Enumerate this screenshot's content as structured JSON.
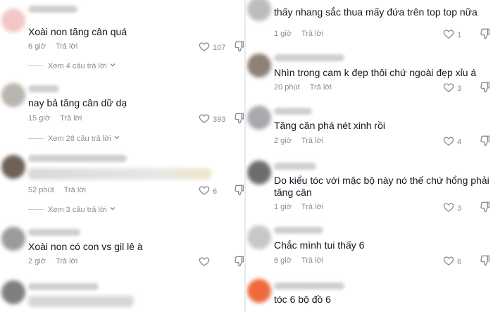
{
  "left": {
    "comments": [
      {
        "text": "Xoài non tăng cân quá",
        "time": "6 giờ",
        "reply": "Trả lời",
        "likes": "107",
        "view_replies": "Xem 4 câu trả lời",
        "avatar_color": "#f2c7c7"
      },
      {
        "text": "nay bả tăng cân dữ dạ",
        "time": "15 giờ",
        "reply": "Trả lời",
        "likes": "393",
        "view_replies": "Xem 28 câu trả lời",
        "avatar_color": "#b8b4ae"
      },
      {
        "text": "",
        "time": "52 phút",
        "reply": "Trả lời",
        "likes": "6",
        "view_replies": "Xem 3 câu trả lời",
        "avatar_color": "#6e6257"
      },
      {
        "text": "Xoài non có con vs gil lê à",
        "time": "2 giờ",
        "reply": "Trả lời",
        "likes": "",
        "avatar_color": "#9c9a9a"
      },
      {
        "text": "",
        "time": "",
        "reply": "",
        "likes": "",
        "avatar_color": "#7f7f7f"
      }
    ]
  },
  "right": {
    "comments": [
      {
        "text": "thấy nhang sắc thua mấy đứa trên top top nữa",
        "time": "1 giờ",
        "reply": "Trả lời",
        "likes": "1",
        "avatar_color": "#bcbcbc"
      },
      {
        "text": "Nhìn trong cam k đẹp thôi chứ ngoài đẹp xỉu á",
        "time": "20 phút",
        "reply": "Trả lời",
        "likes": "3",
        "avatar_color": "#8d8176"
      },
      {
        "text": "Tăng cân phá nét xinh rồi",
        "time": "2 giờ",
        "reply": "Trả lời",
        "likes": "4",
        "avatar_color": "#a7a9ad"
      },
      {
        "text": "Do kiểu tóc với mặc bộ này nó thế chứ hổng phải",
        "text2": "tăng cân",
        "time": "1 giờ",
        "reply": "Trả lời",
        "likes": "3",
        "avatar_color": "#6d6d6d"
      },
      {
        "text": "Chắc mình tui thấy 6",
        "time": "6 giờ",
        "reply": "Trả lời",
        "likes": "6",
        "avatar_color": "#c9c6c8"
      },
      {
        "text": "tóc 6 bộ đồ 6",
        "avatar_color": "#ee6a3c"
      }
    ]
  }
}
